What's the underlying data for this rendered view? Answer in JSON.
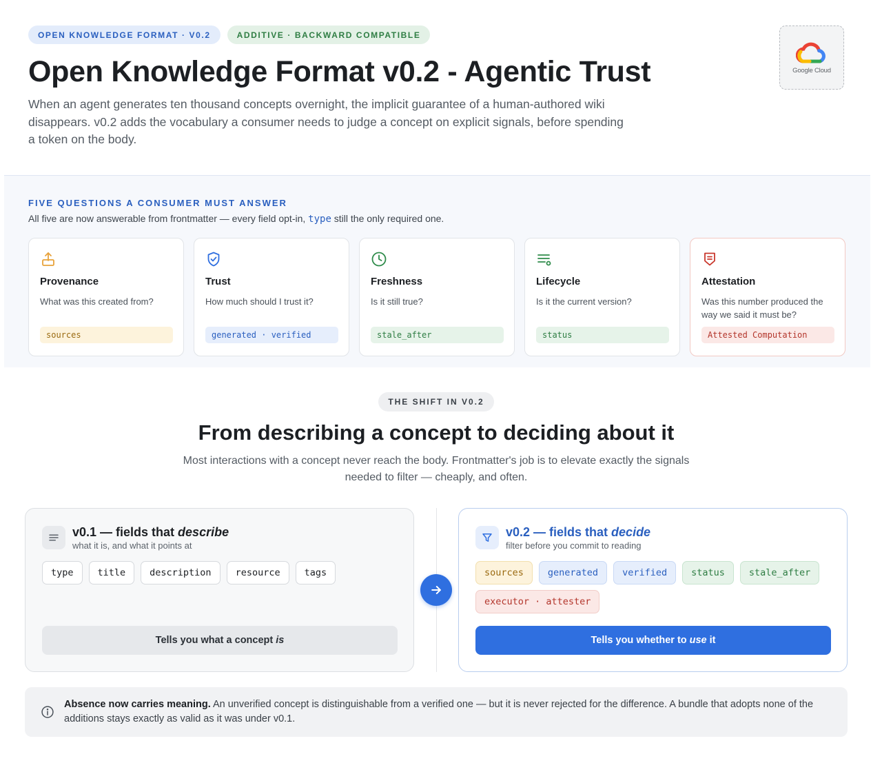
{
  "header": {
    "badge_format": "OPEN KNOWLEDGE FORMAT · V0.2",
    "badge_compat": "ADDITIVE · BACKWARD COMPATIBLE",
    "title": "Open Knowledge Format v0.2 - Agentic Trust",
    "subtitle": "When an agent generates ten thousand concepts overnight, the implicit guarantee of a human-authored wiki disappears. v0.2 adds the vocabulary a consumer needs to judge a concept on explicit signals, before spending a token on the body.",
    "logo_text": "Google Cloud"
  },
  "questions": {
    "eyebrow": "FIVE QUESTIONS A CONSUMER MUST ANSWER",
    "note_before": "All five are now answerable from frontmatter — every field opt-in, ",
    "note_keyword": "type",
    "note_after": " still the only required one.",
    "cards": [
      {
        "icon": "upload-icon",
        "title": "Provenance",
        "question": "What was this created from?",
        "tag": "sources",
        "color": "#e8a23a"
      },
      {
        "icon": "shield-check-icon",
        "title": "Trust",
        "question": "How much should I trust it?",
        "tag": "generated · verified",
        "color": "#2f6fe0"
      },
      {
        "icon": "clock-icon",
        "title": "Freshness",
        "question": "Is it still true?",
        "tag": "stale_after",
        "color": "#2e8b4a"
      },
      {
        "icon": "list-status-icon",
        "title": "Lifecycle",
        "question": "Is it the current version?",
        "tag": "status",
        "color": "#2e8b4a"
      },
      {
        "icon": "seal-icon",
        "title": "Attestation",
        "question": "Was this number produced the way we said it must be?",
        "tag": "Attested Computation",
        "color": "#c9372c"
      }
    ]
  },
  "shift": {
    "eyebrow": "THE SHIFT IN V0.2",
    "title": "From describing a concept to deciding about it",
    "subtitle": "Most interactions with a concept never reach the body. Frontmatter's job is to elevate exactly the signals needed to filter — cheaply, and often."
  },
  "v01": {
    "title_prefix": "v0.1 — fields that ",
    "title_em": "describe",
    "subtitle": "what it is, and what it points at",
    "fields": [
      "type",
      "title",
      "description",
      "resource",
      "tags"
    ],
    "bar_prefix": "Tells you what a concept",
    "bar_em": "is"
  },
  "v02": {
    "title_prefix": "v0.2 — fields that ",
    "title_em": "decide",
    "subtitle": "filter before you commit to reading",
    "fields": [
      {
        "label": "sources",
        "tone": "amber"
      },
      {
        "label": "generated",
        "tone": "blue"
      },
      {
        "label": "verified",
        "tone": "blue"
      },
      {
        "label": "status",
        "tone": "green"
      },
      {
        "label": "stale_after",
        "tone": "green"
      },
      {
        "label": "executor · attester",
        "tone": "red"
      }
    ],
    "bar_prefix": "Tells you whether to",
    "bar_em": "use",
    "bar_suffix": "it"
  },
  "note": {
    "bold": "Absence now carries meaning.",
    "text": " An unverified concept is distinguishable from a verified one — but it is never rejected for the difference. A bundle that adopts none of the additions stays exactly as valid as it was under v0.1."
  }
}
